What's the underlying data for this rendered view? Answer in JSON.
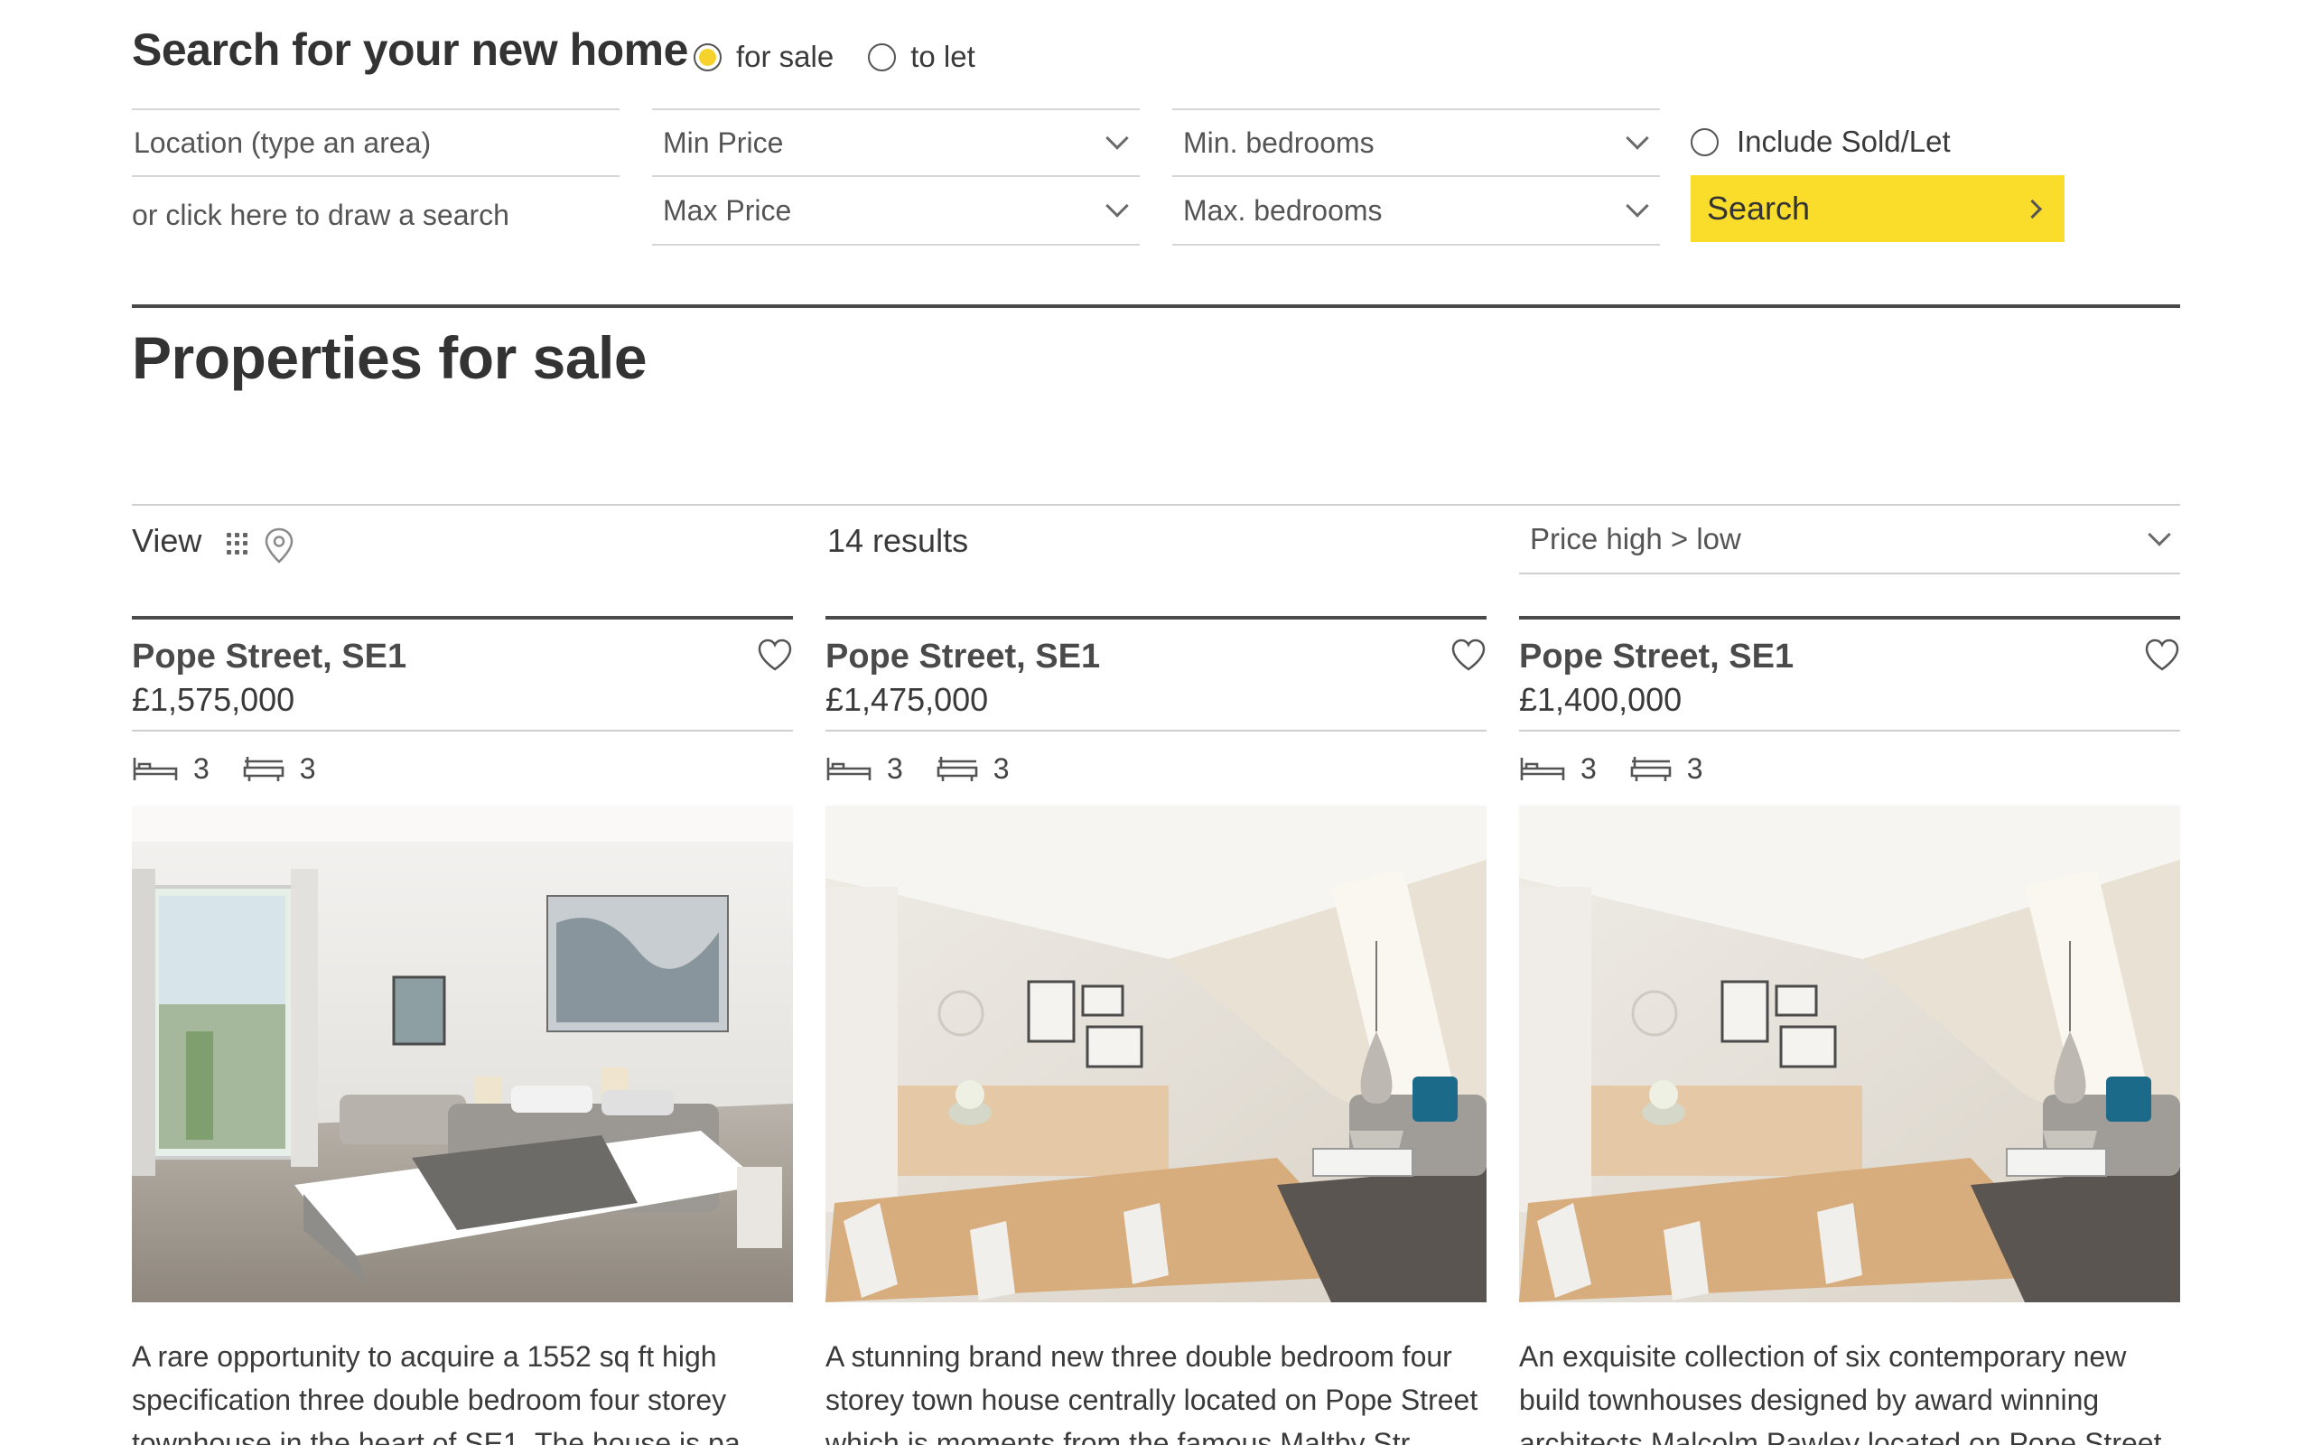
{
  "search": {
    "title": "Search for your new home",
    "mode_options": [
      {
        "label": "for sale",
        "checked": true
      },
      {
        "label": "to let",
        "checked": false
      }
    ],
    "location_placeholder": "Location (type an area)",
    "draw_link": "or click here to draw a search",
    "min_price": "Min Price",
    "max_price": "Max Price",
    "min_bedrooms": "Min. bedrooms",
    "max_bedrooms": "Max. bedrooms",
    "include_sold_label": "Include Sold/Let",
    "search_button": "Search",
    "accent_color": "#fadc2b"
  },
  "page": {
    "heading": "Properties for sale"
  },
  "toolbar": {
    "view_label": "View",
    "view_icons": [
      "grid-icon",
      "map-pin-icon"
    ],
    "results": "14 results",
    "sort_value": "Price high > low"
  },
  "listings": [
    {
      "title": "Pope Street, SE1",
      "price": "£1,575,000",
      "bedrooms": "3",
      "bathrooms": "3",
      "image": "bedroom-render",
      "description": "A rare opportunity to acquire a 1552 sq ft high specification three double bedroom four storey townhouse in the heart of SE1. The house is pa"
    },
    {
      "title": "Pope Street, SE1",
      "price": "£1,475,000",
      "bedrooms": "3",
      "bathrooms": "3",
      "image": "dining-living-render",
      "description": "A stunning brand new three double bedroom four storey town house centrally located on Pope Street which is moments from the famous Maltby Str"
    },
    {
      "title": "Pope Street, SE1",
      "price": "£1,400,000",
      "bedrooms": "3",
      "bathrooms": "3",
      "image": "dining-living-render",
      "description": "An exquisite collection of six contemporary new build townhouses designed by award winning architects Malcolm Pawley located on Pope Street"
    }
  ]
}
